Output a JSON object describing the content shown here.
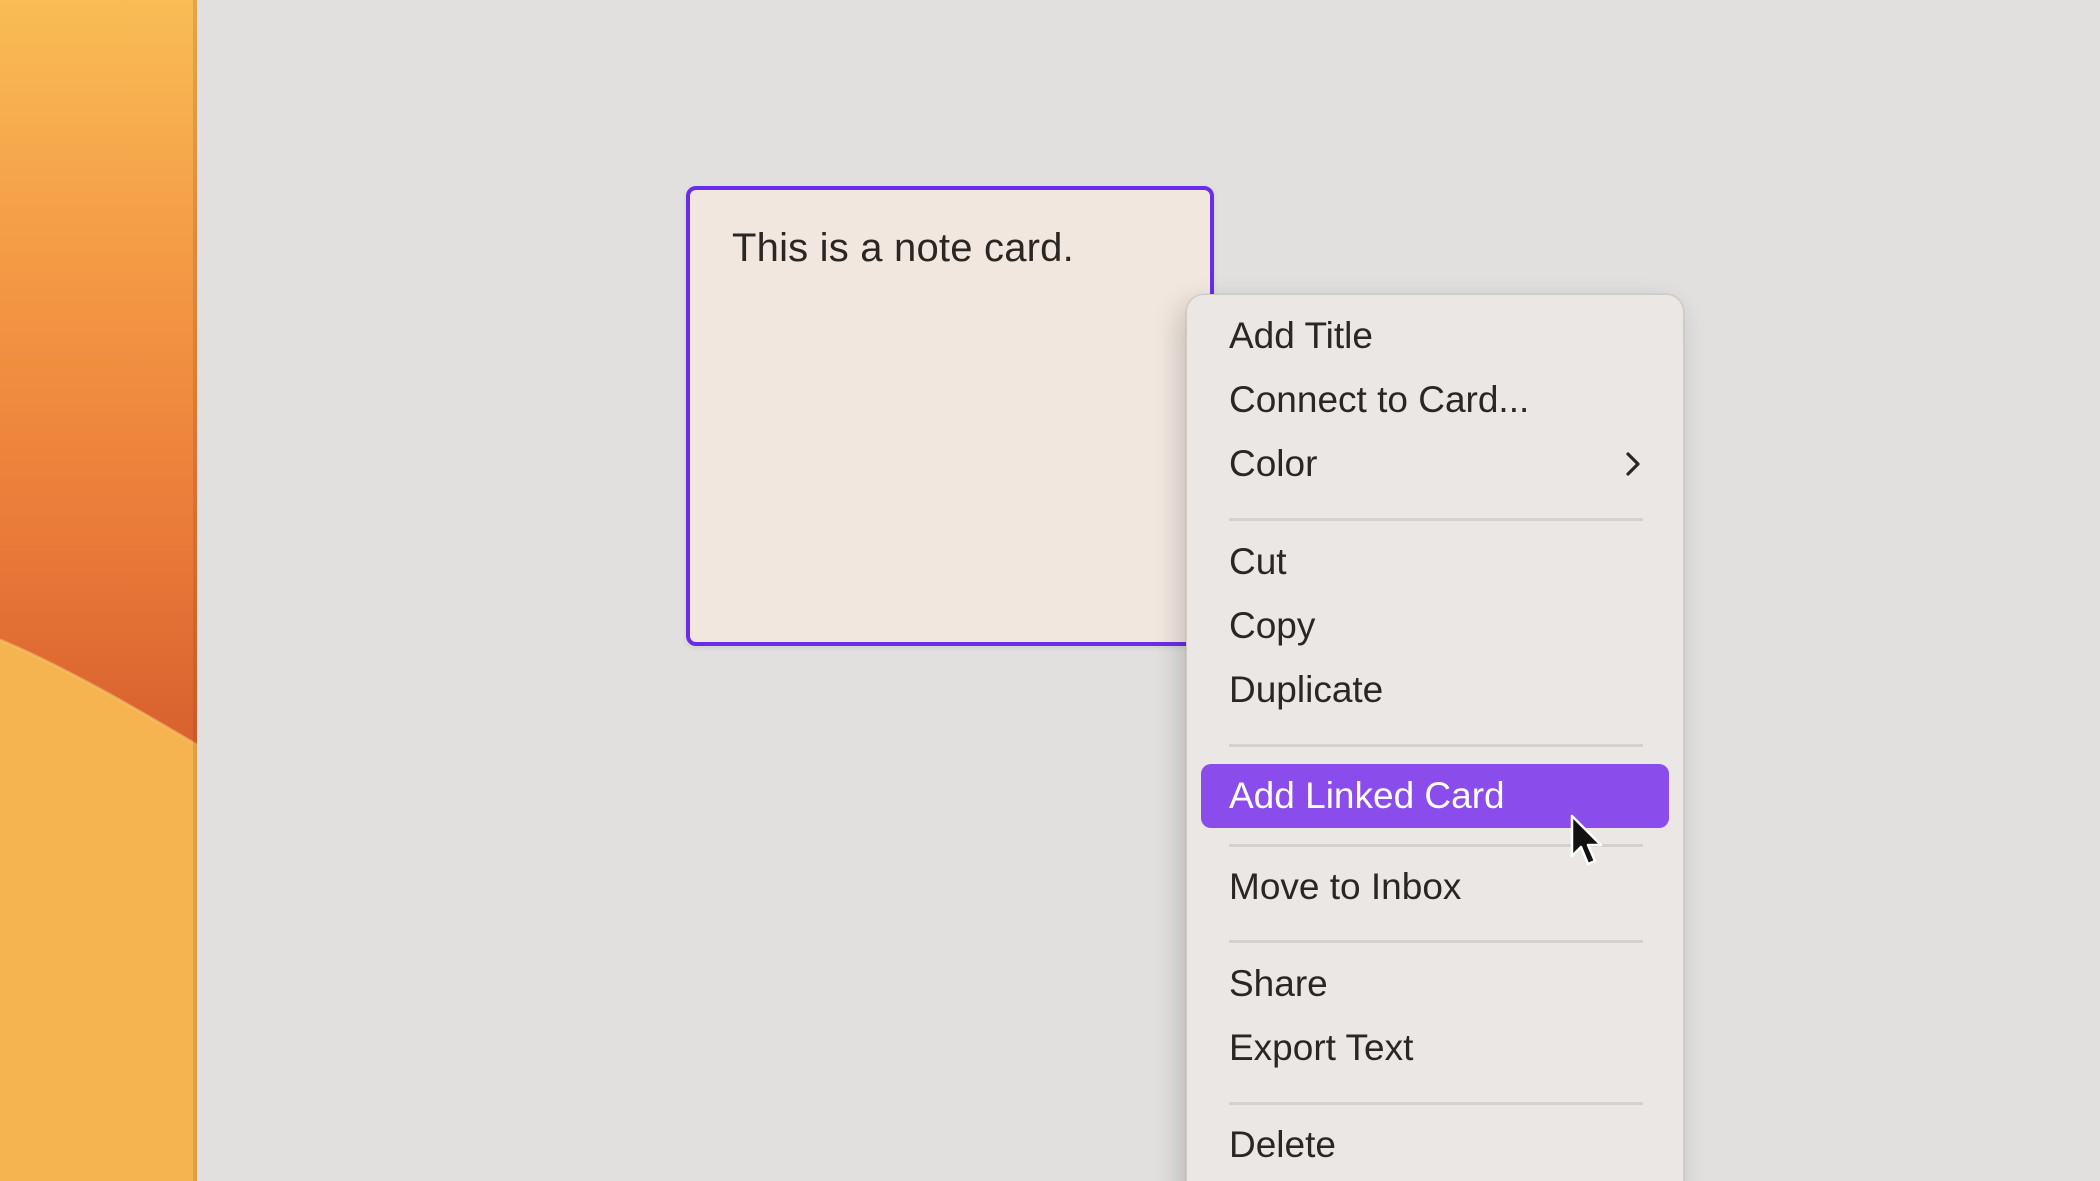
{
  "note_card": {
    "text": "This is a note card.",
    "border_color": "#6a2de7",
    "background_color": "#f1e7df"
  },
  "context_menu": {
    "items": [
      {
        "label": "Add Title"
      },
      {
        "label": "Connect to Card..."
      },
      {
        "label": "Color",
        "submenu_icon": "chevron-right-icon"
      },
      {
        "label": "Cut"
      },
      {
        "label": "Copy"
      },
      {
        "label": "Duplicate"
      },
      {
        "label": "Add Linked Card",
        "state": "highlighted"
      },
      {
        "label": "Move to Inbox"
      },
      {
        "label": "Share"
      },
      {
        "label": "Export Text"
      },
      {
        "label": "Delete"
      }
    ],
    "highlight_color": "#8a4cea"
  },
  "cursor": {
    "icon": "arrow-pointer-icon"
  }
}
